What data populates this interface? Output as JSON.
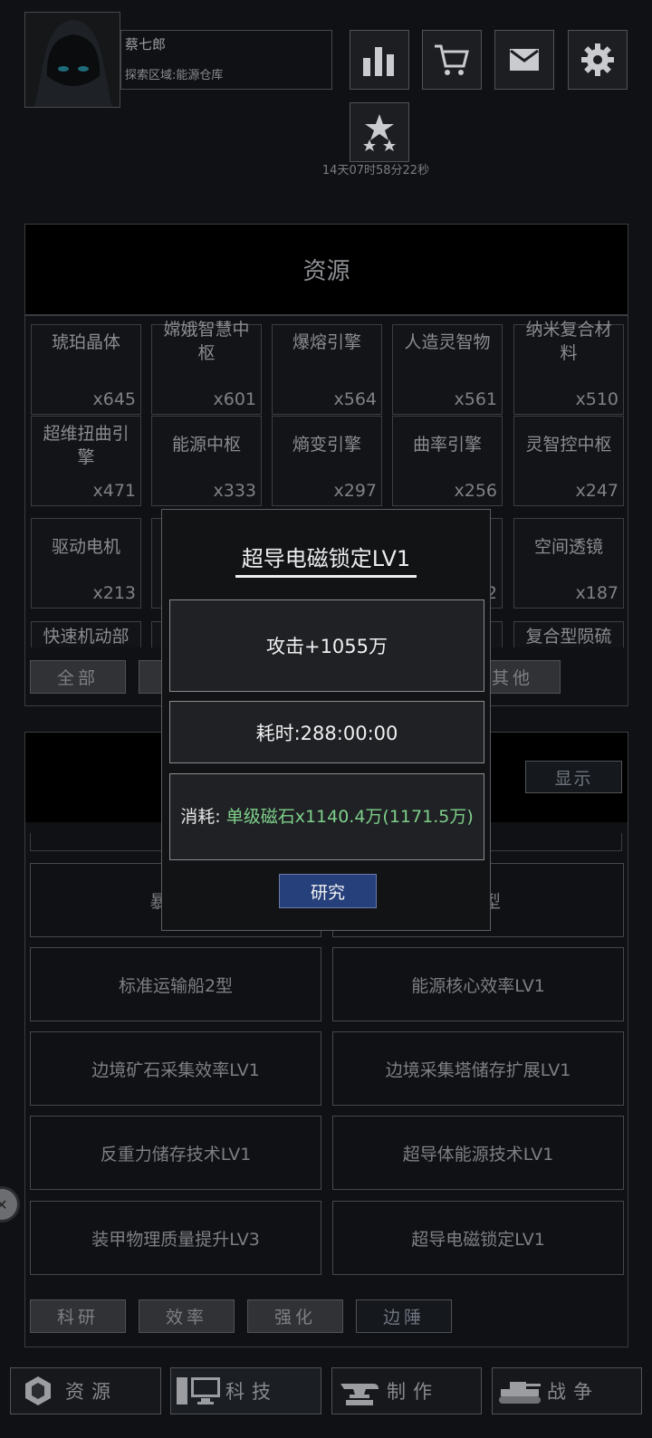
{
  "player": {
    "name": "蔡七郎",
    "zone": "探索区域:能源仓库"
  },
  "header_icons": [
    "stats-icon",
    "cart-icon",
    "mail-icon",
    "gear-icon",
    "star-rank-icon"
  ],
  "timer": "14天07时58分22秒",
  "resources": {
    "title": "资源",
    "items": [
      {
        "name": "琥珀晶体",
        "qty": "x645"
      },
      {
        "name": "嫦娥智慧中枢",
        "qty": "x601"
      },
      {
        "name": "爆熔引擎",
        "qty": "x564"
      },
      {
        "name": "人造灵智物",
        "qty": "x561"
      },
      {
        "name": "纳米复合材料",
        "qty": "x510"
      },
      {
        "name": "超维扭曲引擎",
        "qty": "x471"
      },
      {
        "name": "能源中枢",
        "qty": "x333"
      },
      {
        "name": "熵变引擎",
        "qty": "x297"
      },
      {
        "name": "曲率引擎",
        "qty": "x256"
      },
      {
        "name": "灵智控中枢",
        "qty": "x247"
      },
      {
        "name": "驱动电机",
        "qty": "x213"
      },
      {
        "name": "",
        "qty": ""
      },
      {
        "name": "",
        "qty": ""
      },
      {
        "name": "",
        "qty": "2"
      },
      {
        "name": "空间透镜",
        "qty": "x187"
      },
      {
        "name": "快速机动部",
        "qty": ""
      },
      {
        "name": "",
        "qty": ""
      },
      {
        "name": "",
        "qty": ""
      },
      {
        "name": "",
        "qty": ""
      },
      {
        "name": "复合型陨硫",
        "qty": ""
      }
    ],
    "filters": [
      "全部",
      "",
      "",
      "其他"
    ]
  },
  "tech": {
    "show_button": "显示",
    "items": [
      "暴力运",
      "船1型",
      "标准运输船2型",
      "能源核心效率LV1",
      "边境矿石采集效率LV1",
      "边境采集塔储存扩展LV1",
      "反重力储存技术LV1",
      "超导体能源技术LV1",
      "装甲物理质量提升LV3",
      "超导电磁锁定LV1"
    ],
    "tabs": [
      "科研",
      "效率",
      "强化",
      "边陲"
    ]
  },
  "nav": [
    {
      "label": "资源",
      "icon": "resource-icon"
    },
    {
      "label": "科技",
      "icon": "computer-icon"
    },
    {
      "label": "制作",
      "icon": "anvil-icon"
    },
    {
      "label": "战争",
      "icon": "tank-icon"
    }
  ],
  "modal": {
    "title": "超导电磁锁定LV1",
    "effect": "攻击+1055万",
    "time": "耗时:288:00:00",
    "cost_label": "消耗:",
    "cost_value": "单级磁石x1140.4万(1171.5万)",
    "button": "研究"
  }
}
